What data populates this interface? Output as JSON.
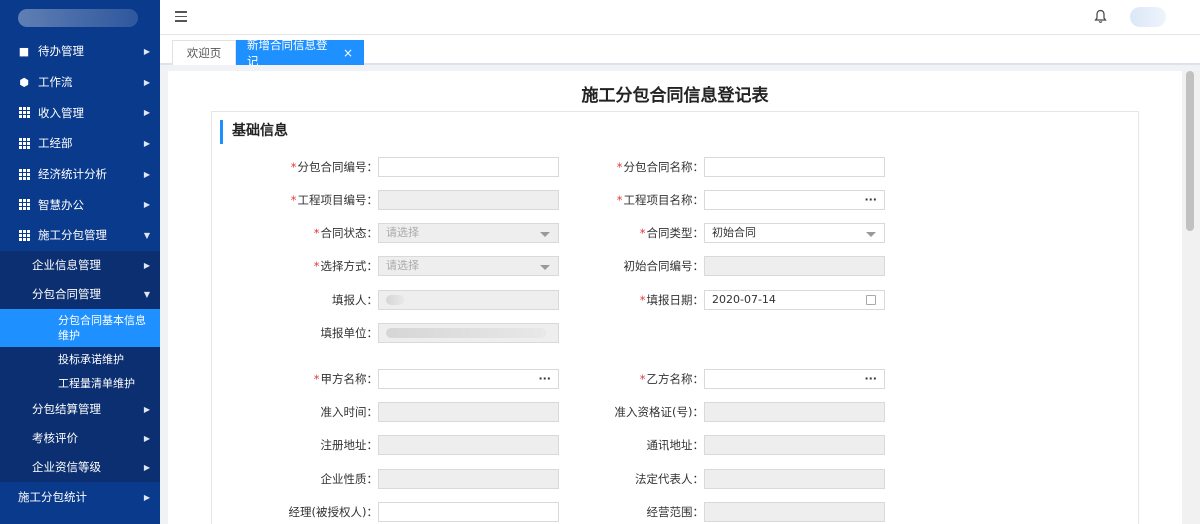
{
  "sidebar": {
    "items": [
      {
        "label": "待办管理",
        "icon": "bookmark-icon"
      },
      {
        "label": "工作流",
        "icon": "cube-icon"
      },
      {
        "label": "收入管理",
        "icon": "grid-icon"
      },
      {
        "label": "工经部",
        "icon": "grid-icon"
      },
      {
        "label": "经济统计分析",
        "icon": "grid-icon"
      },
      {
        "label": "智慧办公",
        "icon": "grid-icon"
      },
      {
        "label": "施工分包管理",
        "icon": "grid-icon"
      }
    ],
    "sub_items": {
      "enterprise": "企业信息管理",
      "contract": "分包合同管理",
      "contract_basic": "分包合同基本信息维护",
      "bid": "投标承诺维护",
      "bill": "工程量清单维护",
      "settlement": "分包结算管理",
      "evaluation": "考核评价",
      "credit": "企业资信等级"
    },
    "bottom_item": "施工分包统计"
  },
  "tabs": {
    "welcome": "欢迎页",
    "current": "新增合同信息登记",
    "close": "×"
  },
  "form": {
    "title": "施工分包合同信息登记表",
    "section": "基础信息",
    "required_mark": "*",
    "fields": {
      "contract_no": {
        "label": "分包合同编号："
      },
      "contract_name": {
        "label": "分包合同名称："
      },
      "project_no": {
        "label": "工程项目编号："
      },
      "project_name": {
        "label": "工程项目名称："
      },
      "contract_status": {
        "label": "合同状态：",
        "placeholder": "请选择"
      },
      "contract_type": {
        "label": "合同类型：",
        "value": "初始合同"
      },
      "select_method": {
        "label": "选择方式：",
        "placeholder": "请选择"
      },
      "initial_contract_no": {
        "label": "初始合同编号："
      },
      "reporter": {
        "label": "填报人："
      },
      "report_date": {
        "label": "填报日期：",
        "value": "2020-07-14"
      },
      "report_unit": {
        "label": "填报单位："
      },
      "party_a": {
        "label": "甲方名称："
      },
      "party_b": {
        "label": "乙方名称："
      },
      "admission_time": {
        "label": "准入时间："
      },
      "admission_cert": {
        "label": "准入资格证(号)："
      },
      "reg_address": {
        "label": "注册地址："
      },
      "mail_address": {
        "label": "通讯地址："
      },
      "enterprise_nature": {
        "label": "企业性质："
      },
      "legal_rep": {
        "label": "法定代表人："
      },
      "manager": {
        "label": "经理(被授权人)："
      },
      "business_scope": {
        "label": "经营范围："
      }
    },
    "dots": "···"
  },
  "colors": {
    "sidebar": "#0a3a8c",
    "active": "#1e90ff",
    "required": "#e53935"
  }
}
